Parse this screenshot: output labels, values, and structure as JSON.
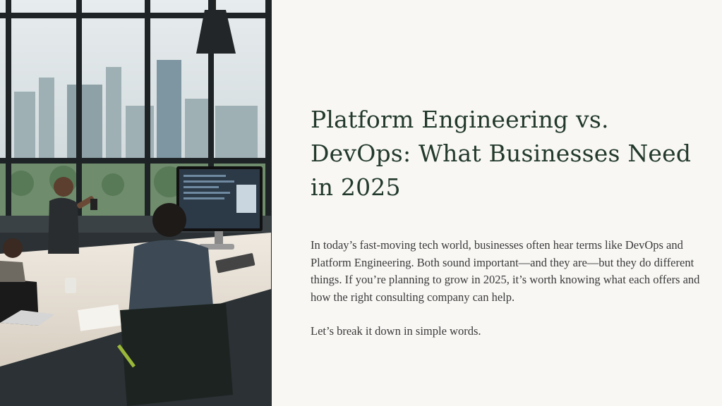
{
  "slide": {
    "title": "Platform Engineering vs. DevOps: What Businesses Need in 2025",
    "paragraphs": [
      "In today’s fast-moving tech world, businesses often hear terms like DevOps and Platform Engineering. Both sound important—and they are—but they do different things. If you’re planning to grow in 2025, it’s worth knowing what each offers and how the right consulting company can help.",
      "Let’s break it down in simple words."
    ]
  },
  "colors": {
    "title": "#22392b",
    "body": "#3a3a3a",
    "panel_background": "#f8f7f4"
  }
}
